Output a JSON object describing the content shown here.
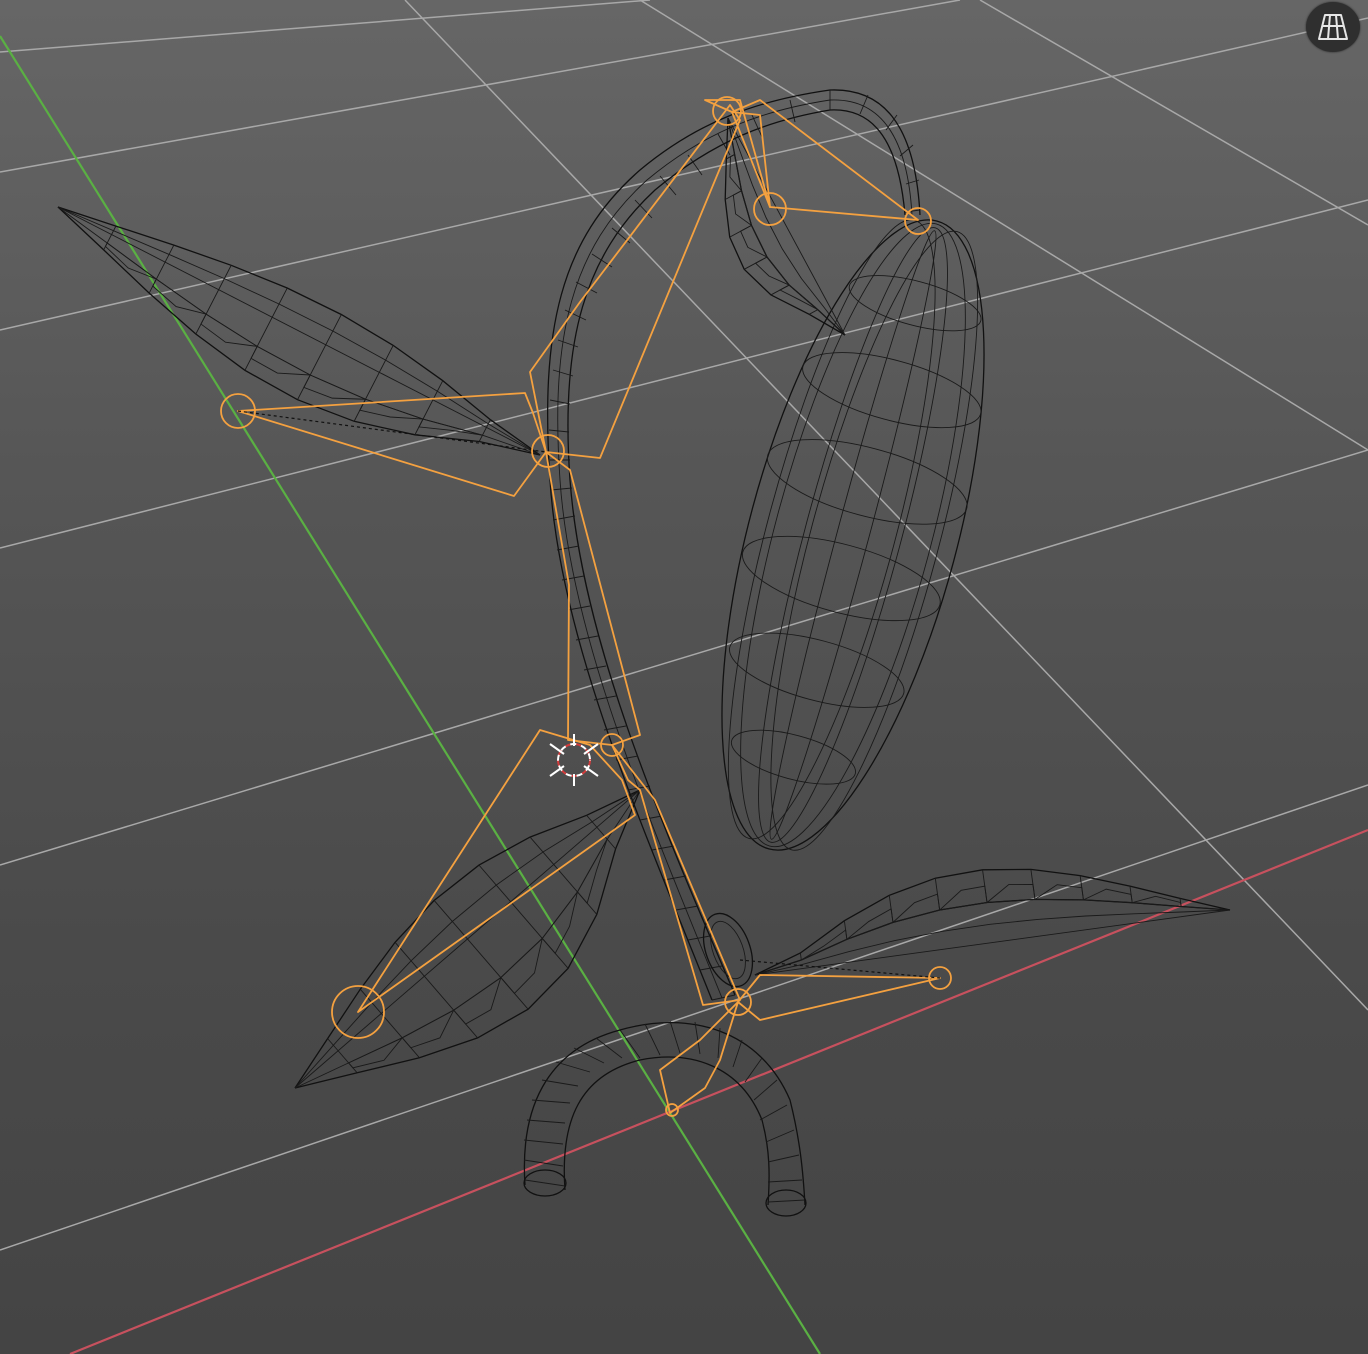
{
  "viewport": {
    "background": "#595959",
    "grid_color": "#a8a8a8",
    "x_axis_color": "#c7515e",
    "y_axis_color": "#5ab043",
    "wire_color": "#111111",
    "armature_color": "#f4a140"
  },
  "navigation": {
    "toggle_perspective": {
      "icon": "grid-perspective-icon"
    }
  },
  "scene": {
    "mesh_objects": [
      {
        "kind": "stem"
      },
      {
        "kind": "pod"
      },
      {
        "kind": "leaf",
        "position": "upper-left"
      },
      {
        "kind": "leaf",
        "position": "top"
      },
      {
        "kind": "leaf",
        "position": "lower-left"
      },
      {
        "kind": "leaf",
        "position": "lower-right"
      },
      {
        "kind": "root-arc"
      }
    ],
    "armature_bone_count": 9,
    "cursor": {
      "icon": "3d-cursor-icon"
    }
  }
}
